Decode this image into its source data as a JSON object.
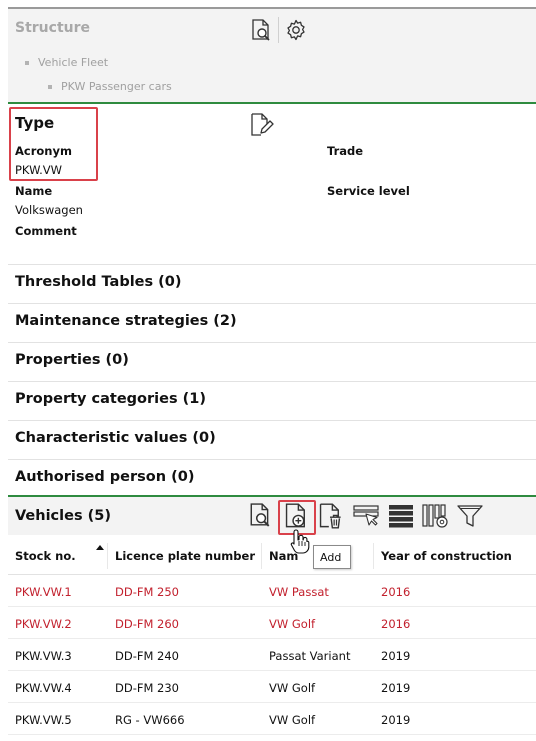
{
  "structure": {
    "title": "Structure",
    "tree": [
      "Vehicle Fleet",
      "PKW Passenger cars"
    ]
  },
  "type": {
    "title": "Type",
    "fields": {
      "acronym_label": "Acronym",
      "acronym_value": "PKW.VW",
      "trade_label": "Trade",
      "name_label": "Name",
      "name_value": "Volkswagen",
      "service_level_label": "Service level",
      "comment_label": "Comment"
    }
  },
  "sections": [
    "Threshold Tables (0)",
    "Maintenance strategies (2)",
    "Properties (0)",
    "Property categories (1)",
    "Characteristic values (0)",
    "Authorised person (0)"
  ],
  "vehicles": {
    "title": "Vehicles (5)",
    "tooltip": "Add",
    "columns": [
      "Stock no.",
      "Licence plate number",
      "Nam",
      "Year of construction"
    ],
    "rows": [
      [
        "PKW.VW.1",
        "DD-FM 250",
        "VW Passat",
        "2016"
      ],
      [
        "PKW.VW.2",
        "DD-FM 260",
        "VW Golf",
        "2016"
      ],
      [
        "PKW.VW.3",
        "DD-FM 240",
        "Passat Variant",
        "2019"
      ],
      [
        "PKW.VW.4",
        "DD-FM 230",
        "VW Golf",
        "2019"
      ],
      [
        "PKW.VW.5",
        "RG - VW666",
        "VW Golf",
        "2019"
      ]
    ]
  },
  "colors": {
    "accent_green": "#2e8b3f",
    "highlight_red": "#d9414a",
    "row_red_text": "#c2202d"
  },
  "icons": [
    "document-search-icon",
    "gear-icon",
    "document-edit-icon",
    "document-add-icon",
    "document-delete-icon",
    "select-rows-icon",
    "rows-icon",
    "column-settings-icon",
    "filter-icon",
    "hand-cursor-icon"
  ]
}
